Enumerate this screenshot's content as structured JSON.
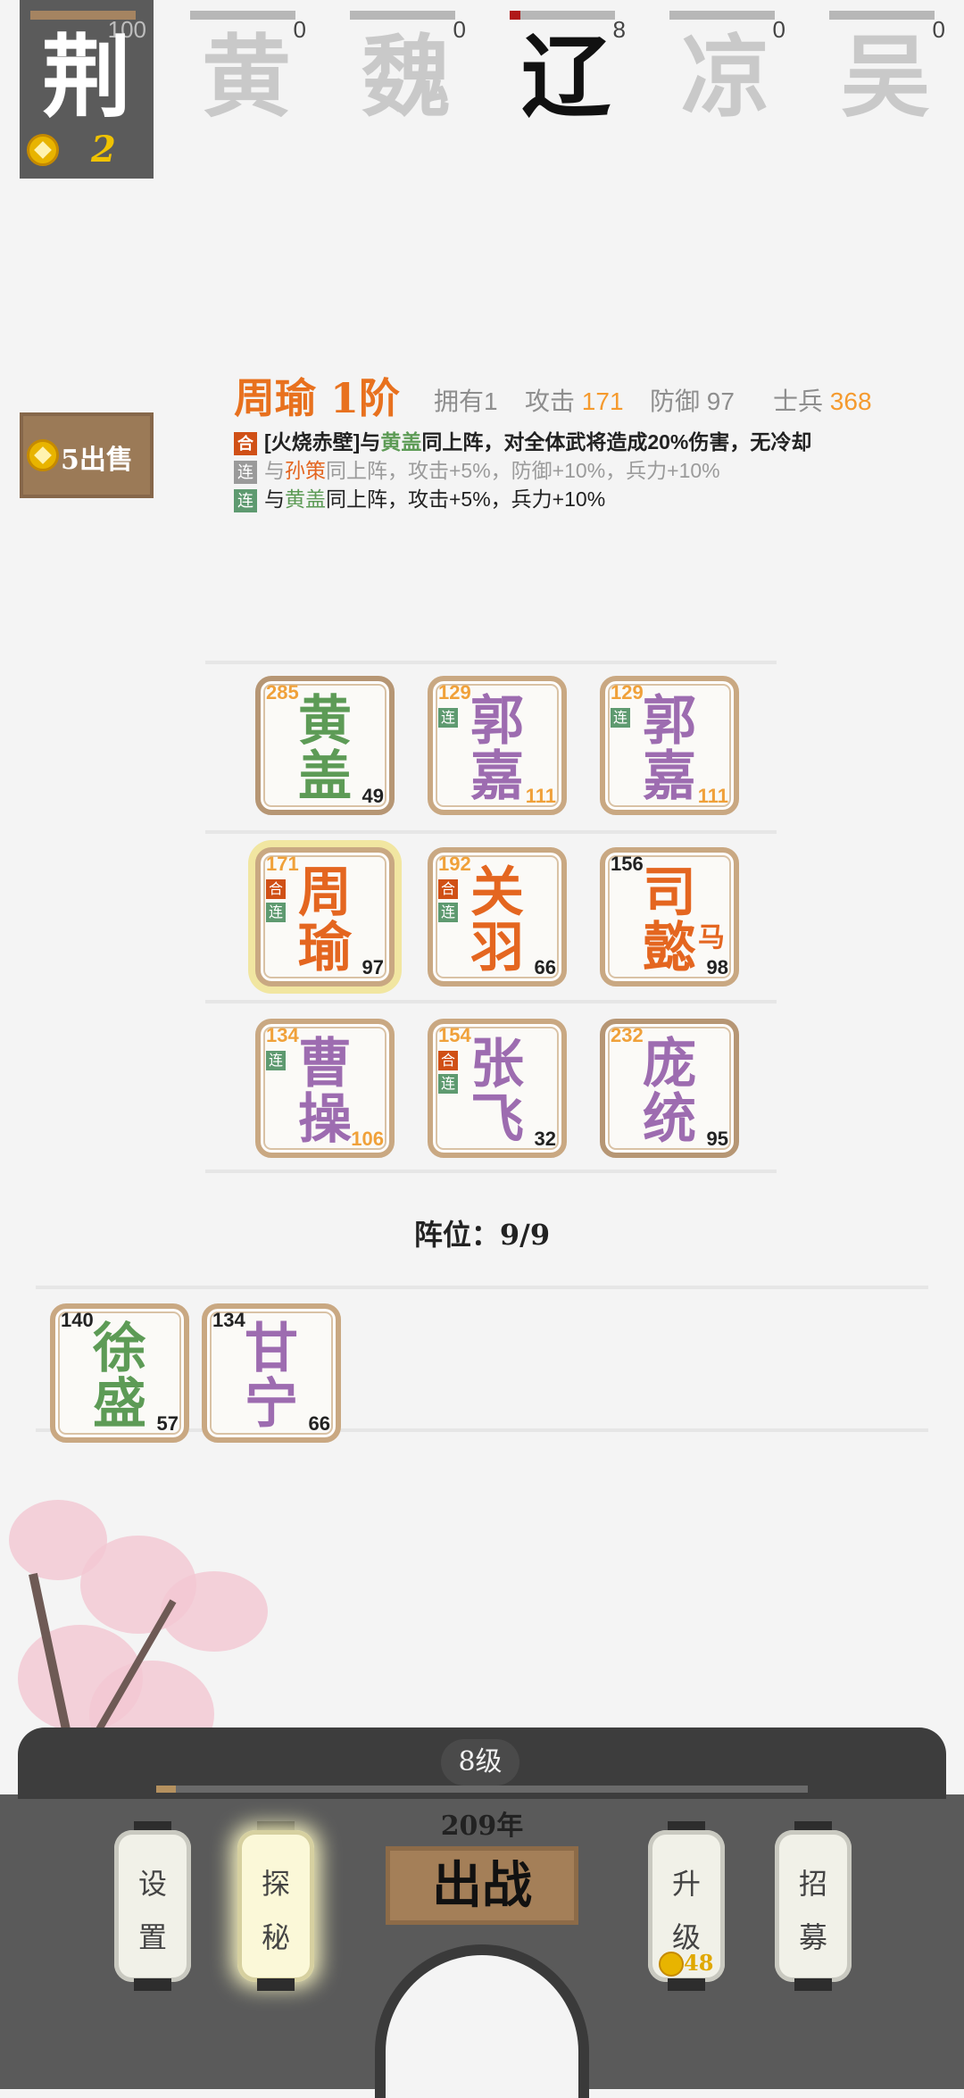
{
  "factions": [
    {
      "name": "荆",
      "count": "100",
      "active": true
    },
    {
      "name": "黄",
      "count": "0"
    },
    {
      "name": "魏",
      "count": "0"
    },
    {
      "name": "辽",
      "count": "8",
      "bold": true,
      "progress": 0.08
    },
    {
      "name": "凉",
      "count": "0"
    },
    {
      "name": "吴",
      "count": "0"
    }
  ],
  "coins": "2",
  "hero": {
    "name": "周瑜 1阶",
    "owned": "拥有1",
    "attack_label": "攻击",
    "attack": "171",
    "defense_label": "防御",
    "defense": "97",
    "troops_label": "士兵",
    "troops": "368"
  },
  "skills": [
    {
      "tag": "合",
      "pre": "[火烧赤壁]与",
      "partner": "黄盖",
      "post": "同上阵，对全体武将造成20%伤害，无冷却"
    },
    {
      "tag": "连",
      "pre": "与",
      "partner": "孙策",
      "post": "同上阵，攻击+5%，防御+10%，兵力+10%"
    },
    {
      "tag": "连",
      "pre": "与",
      "partner": "黄盖",
      "post": "同上阵，攻击+5%，兵力+10%"
    }
  ],
  "sell": {
    "price": "5",
    "label": "出售"
  },
  "grid": [
    {
      "name1": "黄",
      "name2": "盖",
      "atk": "285",
      "def": "49",
      "color": "green",
      "gold": true
    },
    {
      "name1": "郭",
      "name2": "嘉",
      "atk": "129",
      "def": "111",
      "color": "purple",
      "tags": [
        "连"
      ]
    },
    {
      "name1": "郭",
      "name2": "嘉",
      "atk": "129",
      "def": "111",
      "color": "purple",
      "tags": [
        "连"
      ]
    },
    {
      "name1": "周",
      "name2": "瑜",
      "atk": "171",
      "def": "97",
      "color": "orange",
      "tags": [
        "合",
        "连"
      ],
      "selected": true
    },
    {
      "name1": "关",
      "name2": "羽",
      "atk": "192",
      "def": "66",
      "color": "orange",
      "tags": [
        "合",
        "连"
      ]
    },
    {
      "name1": "司",
      "name2": "懿",
      "side": "马",
      "atk": "156",
      "def": "98",
      "color": "orange"
    },
    {
      "name1": "曹",
      "name2": "操",
      "atk": "134",
      "def": "106",
      "color": "purple",
      "tags": [
        "连"
      ]
    },
    {
      "name1": "张",
      "name2": "飞",
      "atk": "154",
      "def": "32",
      "color": "purple",
      "tags": [
        "合",
        "连"
      ]
    },
    {
      "name1": "庞",
      "name2": "统",
      "atk": "232",
      "def": "95",
      "color": "purple",
      "gold": true
    }
  ],
  "formation": "阵位：9/9",
  "bench": [
    {
      "name1": "徐",
      "name2": "盛",
      "atk": "140",
      "def": "57",
      "color": "green"
    },
    {
      "name1": "甘",
      "name2": "宁",
      "atk": "134",
      "def": "66",
      "color": "purple"
    }
  ],
  "level": "8级",
  "level_progress": 0.03,
  "year": "209年",
  "buttons": {
    "settings": "设置",
    "explore": "探秘",
    "fight": "出战",
    "upgrade": "升级",
    "upgrade_cost": "48",
    "recruit": "招募"
  },
  "colors": {
    "orange": "#e46620",
    "purple": "#9d6cb0",
    "green": "#5d9b56",
    "wood": "#a47f58"
  }
}
